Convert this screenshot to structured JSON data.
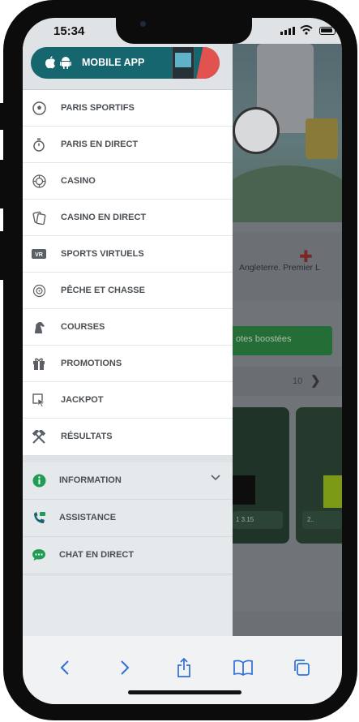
{
  "status_bar": {
    "time": "15:34"
  },
  "app_banner": {
    "label": "MOBILE APP"
  },
  "menu": {
    "items": [
      {
        "label": "PARIS SPORTIFS",
        "icon": "soccer-ball-icon"
      },
      {
        "label": "PARIS EN DIRECT",
        "icon": "stopwatch-icon"
      },
      {
        "label": "CASINO",
        "icon": "casino-chip-icon"
      },
      {
        "label": "CASINO EN DIRECT",
        "icon": "cards-icon"
      },
      {
        "label": "SPORTS VIRTUELS",
        "icon": "vr-icon"
      },
      {
        "label": "PÊCHE ET CHASSE",
        "icon": "target-icon"
      },
      {
        "label": "COURSES",
        "icon": "horse-icon"
      },
      {
        "label": "PROMOTIONS",
        "icon": "gift-icon"
      },
      {
        "label": "JACKPOT",
        "icon": "jackpot-cursor-icon"
      },
      {
        "label": "RÉSULTATS",
        "icon": "crossed-hammers-icon"
      }
    ],
    "group": [
      {
        "label": "INFORMATION",
        "icon": "info-icon",
        "color": "#1f9d55"
      },
      {
        "label": "ASSISTANCE",
        "icon": "phone-icon",
        "color": "#16666f"
      },
      {
        "label": "CHAT EN DIRECT",
        "icon": "chat-icon",
        "color": "#1f9d55"
      }
    ]
  },
  "background_page": {
    "match": "Angleterre. Premier L",
    "promo_button": "otes boostées",
    "count": "10",
    "odd1": "1 3.15",
    "odd2": "2.."
  },
  "colors": {
    "brand": "#16666f",
    "accent_green": "#1f9d55",
    "promo_red": "#e2534f"
  }
}
